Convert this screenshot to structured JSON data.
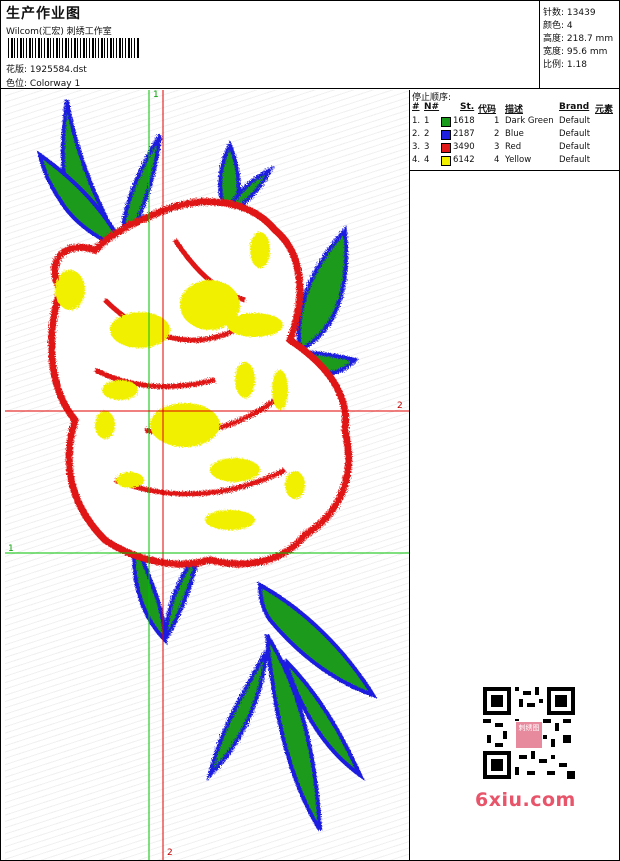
{
  "header": {
    "title": "生产作业图",
    "company": "Wilcom(汇宏) 刺绣工作室",
    "design_label": "花版:",
    "design_value": "1925584.dst",
    "colorway_label": "色位:",
    "colorway_value": "Colorway 1"
  },
  "stats": {
    "stitches_label": "针数:",
    "stitches_value": "13439",
    "colors_label": "颜色:",
    "colors_value": "4",
    "height_label": "高度:",
    "height_value": "218.7 mm",
    "width_label": "宽度:",
    "width_value": "95.6 mm",
    "scale_label": "比例:",
    "scale_value": "1.18"
  },
  "stop_sequence": {
    "title": "停止顺序:",
    "headers": {
      "num": "#",
      "needle": "N#",
      "stitches": "St.",
      "code": "代码",
      "desc": "描述",
      "brand": "Brand",
      "element": "元素"
    },
    "rows": [
      {
        "num": "1.",
        "needle": "1",
        "color": "#1a9a1a",
        "stitches": "1618",
        "code": "1",
        "desc": "Dark Green",
        "brand": "Default"
      },
      {
        "num": "2.",
        "needle": "2",
        "color": "#1f1fe0",
        "stitches": "2187",
        "code": "2",
        "desc": "Blue",
        "brand": "Default"
      },
      {
        "num": "3.",
        "needle": "3",
        "color": "#e01818",
        "stitches": "3490",
        "code": "3",
        "desc": "Red",
        "brand": "Default"
      },
      {
        "num": "4.",
        "needle": "4",
        "color": "#f0f000",
        "stitches": "6142",
        "code": "4",
        "desc": "Yellow",
        "brand": "Default"
      }
    ]
  },
  "guides": {
    "v_green": "1",
    "h_red": "2",
    "h_green": "1",
    "v_red": "2"
  },
  "colors": {
    "green_thread": "#1a9a1a",
    "blue_thread": "#1f1fe0",
    "red_thread": "#e01818",
    "yellow_thread": "#f0f000",
    "guide_red": "#e00000",
    "guide_green": "#00c000"
  },
  "watermark": {
    "text": "6xiu.com",
    "stamp_text": "刺绣图"
  }
}
